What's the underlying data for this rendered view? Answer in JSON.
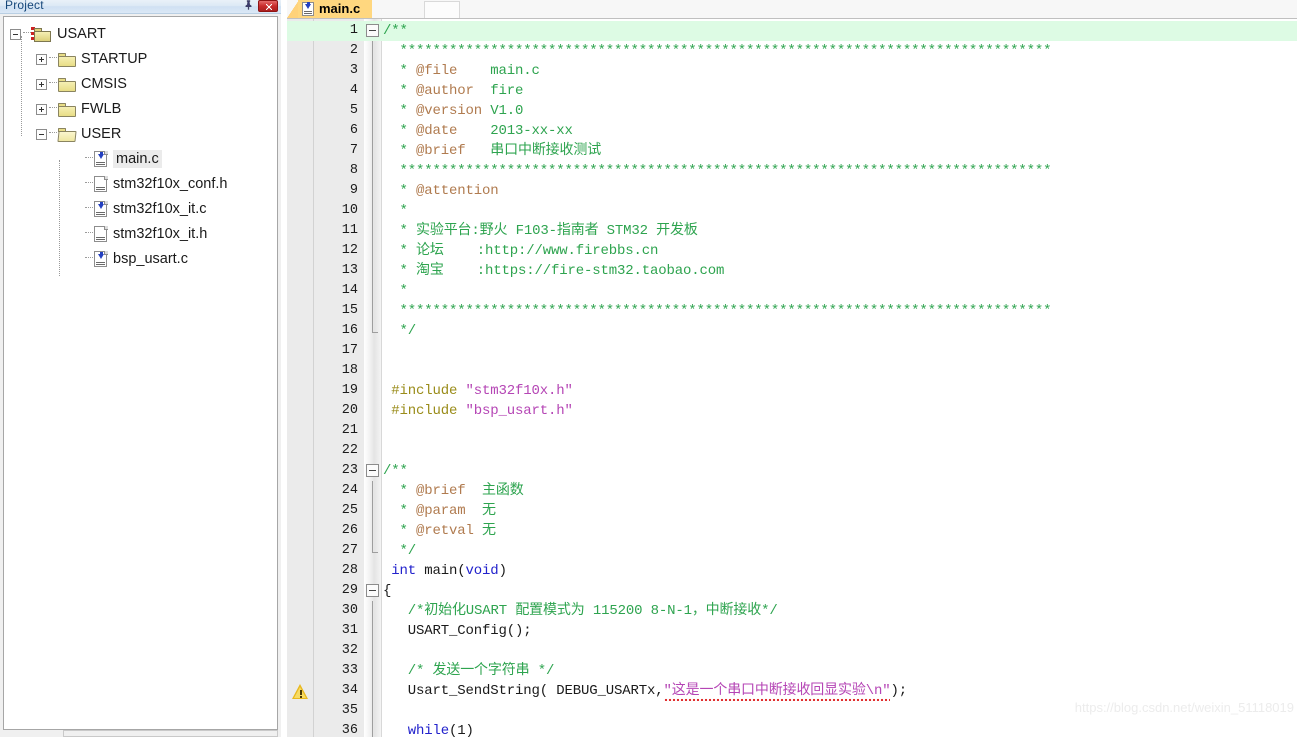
{
  "panel": {
    "title": "Project",
    "pin_icon": "pushpin-icon",
    "close_icon": "close-icon"
  },
  "tree": [
    {
      "label": "USART",
      "depth": 0,
      "icon": "project-folder-icon",
      "expander": "minus",
      "selected": false
    },
    {
      "label": "STARTUP",
      "depth": 1,
      "icon": "folder-icon",
      "expander": "plus",
      "selected": false
    },
    {
      "label": "CMSIS",
      "depth": 1,
      "icon": "folder-icon",
      "expander": "plus",
      "selected": false
    },
    {
      "label": "FWLB",
      "depth": 1,
      "icon": "folder-icon",
      "expander": "plus",
      "selected": false
    },
    {
      "label": "USER",
      "depth": 1,
      "icon": "folder-open-icon",
      "expander": "minus",
      "selected": false
    },
    {
      "label": "main.c",
      "depth": 2,
      "icon": "c-source-file-icon",
      "expander": "none",
      "selected": true
    },
    {
      "label": "stm32f10x_conf.h",
      "depth": 2,
      "icon": "header-file-icon",
      "expander": "none",
      "selected": false
    },
    {
      "label": "stm32f10x_it.c",
      "depth": 2,
      "icon": "c-source-file-icon",
      "expander": "none",
      "selected": false
    },
    {
      "label": "stm32f10x_it.h",
      "depth": 2,
      "icon": "header-file-icon",
      "expander": "none",
      "selected": false
    },
    {
      "label": "bsp_usart.c",
      "depth": 2,
      "icon": "c-source-file-icon",
      "expander": "none",
      "selected": false
    }
  ],
  "editor": {
    "active_tab": "main.c",
    "tab_icon": "c-source-file-icon",
    "lines": [
      {
        "n": 1,
        "fold": "start",
        "warn": false,
        "hl": true,
        "tokens": [
          {
            "t": "/**",
            "c": "cmt"
          }
        ]
      },
      {
        "n": 2,
        "fold": "body",
        "warn": false,
        "hl": false,
        "tokens": [
          {
            "t": "  *******************************************************************************",
            "c": "cmt"
          }
        ]
      },
      {
        "n": 3,
        "fold": "body",
        "warn": false,
        "hl": false,
        "tokens": [
          {
            "t": "  * ",
            "c": "cmt"
          },
          {
            "t": "@file",
            "c": "tag"
          },
          {
            "t": "    main.c",
            "c": "cmt"
          }
        ]
      },
      {
        "n": 4,
        "fold": "body",
        "warn": false,
        "hl": false,
        "tokens": [
          {
            "t": "  * ",
            "c": "cmt"
          },
          {
            "t": "@author",
            "c": "tag"
          },
          {
            "t": "  fire",
            "c": "cmt"
          }
        ]
      },
      {
        "n": 5,
        "fold": "body",
        "warn": false,
        "hl": false,
        "tokens": [
          {
            "t": "  * ",
            "c": "cmt"
          },
          {
            "t": "@version",
            "c": "tag"
          },
          {
            "t": " V1.0",
            "c": "cmt"
          }
        ]
      },
      {
        "n": 6,
        "fold": "body",
        "warn": false,
        "hl": false,
        "tokens": [
          {
            "t": "  * ",
            "c": "cmt"
          },
          {
            "t": "@date",
            "c": "tag"
          },
          {
            "t": "    2013-xx-xx",
            "c": "cmt"
          }
        ]
      },
      {
        "n": 7,
        "fold": "body",
        "warn": false,
        "hl": false,
        "tokens": [
          {
            "t": "  * ",
            "c": "cmt"
          },
          {
            "t": "@brief",
            "c": "tag"
          },
          {
            "t": "   串口中断接收测试",
            "c": "cmt"
          }
        ]
      },
      {
        "n": 8,
        "fold": "body",
        "warn": false,
        "hl": false,
        "tokens": [
          {
            "t": "  *******************************************************************************",
            "c": "cmt"
          }
        ]
      },
      {
        "n": 9,
        "fold": "body",
        "warn": false,
        "hl": false,
        "tokens": [
          {
            "t": "  * ",
            "c": "cmt"
          },
          {
            "t": "@attention",
            "c": "tag"
          }
        ]
      },
      {
        "n": 10,
        "fold": "body",
        "warn": false,
        "hl": false,
        "tokens": [
          {
            "t": "  *",
            "c": "cmt"
          }
        ]
      },
      {
        "n": 11,
        "fold": "body",
        "warn": false,
        "hl": false,
        "tokens": [
          {
            "t": "  * 实验平台:野火 F103-指南者 STM32 开发板",
            "c": "cmt"
          }
        ]
      },
      {
        "n": 12,
        "fold": "body",
        "warn": false,
        "hl": false,
        "tokens": [
          {
            "t": "  * 论坛    :http://www.firebbs.cn",
            "c": "cmt"
          }
        ]
      },
      {
        "n": 13,
        "fold": "body",
        "warn": false,
        "hl": false,
        "tokens": [
          {
            "t": "  * 淘宝    :https://fire-stm32.taobao.com",
            "c": "cmt"
          }
        ]
      },
      {
        "n": 14,
        "fold": "body",
        "warn": false,
        "hl": false,
        "tokens": [
          {
            "t": "  *",
            "c": "cmt"
          }
        ]
      },
      {
        "n": 15,
        "fold": "body",
        "warn": false,
        "hl": false,
        "tokens": [
          {
            "t": "  *******************************************************************************",
            "c": "cmt"
          }
        ]
      },
      {
        "n": 16,
        "fold": "end",
        "warn": false,
        "hl": false,
        "tokens": [
          {
            "t": "  */",
            "c": "cmt"
          }
        ]
      },
      {
        "n": 17,
        "fold": "none",
        "warn": false,
        "hl": false,
        "tokens": []
      },
      {
        "n": 18,
        "fold": "none",
        "warn": false,
        "hl": false,
        "tokens": []
      },
      {
        "n": 19,
        "fold": "none",
        "warn": false,
        "hl": false,
        "tokens": [
          {
            "t": " #include ",
            "c": "pre"
          },
          {
            "t": "\"stm32f10x.h\"",
            "c": "str"
          }
        ]
      },
      {
        "n": 20,
        "fold": "none",
        "warn": false,
        "hl": false,
        "tokens": [
          {
            "t": " #include ",
            "c": "pre"
          },
          {
            "t": "\"bsp_usart.h\"",
            "c": "str"
          }
        ]
      },
      {
        "n": 21,
        "fold": "none",
        "warn": false,
        "hl": false,
        "tokens": []
      },
      {
        "n": 22,
        "fold": "none",
        "warn": false,
        "hl": false,
        "tokens": []
      },
      {
        "n": 23,
        "fold": "start",
        "warn": false,
        "hl": false,
        "tokens": [
          {
            "t": "/**",
            "c": "cmt"
          }
        ]
      },
      {
        "n": 24,
        "fold": "body",
        "warn": false,
        "hl": false,
        "tokens": [
          {
            "t": "  * ",
            "c": "cmt"
          },
          {
            "t": "@brief",
            "c": "tag"
          },
          {
            "t": "  主函数",
            "c": "cmt"
          }
        ]
      },
      {
        "n": 25,
        "fold": "body",
        "warn": false,
        "hl": false,
        "tokens": [
          {
            "t": "  * ",
            "c": "cmt"
          },
          {
            "t": "@param",
            "c": "tag"
          },
          {
            "t": "  无",
            "c": "cmt"
          }
        ]
      },
      {
        "n": 26,
        "fold": "body",
        "warn": false,
        "hl": false,
        "tokens": [
          {
            "t": "  * ",
            "c": "cmt"
          },
          {
            "t": "@retval",
            "c": "tag"
          },
          {
            "t": " 无",
            "c": "cmt"
          }
        ]
      },
      {
        "n": 27,
        "fold": "end",
        "warn": false,
        "hl": false,
        "tokens": [
          {
            "t": "  */",
            "c": "cmt"
          }
        ]
      },
      {
        "n": 28,
        "fold": "none",
        "warn": false,
        "hl": false,
        "tokens": [
          {
            "t": " ",
            "c": "plain"
          },
          {
            "t": "int",
            "c": "kw"
          },
          {
            "t": " main(",
            "c": "plain"
          },
          {
            "t": "void",
            "c": "kw"
          },
          {
            "t": ")",
            "c": "plain"
          }
        ]
      },
      {
        "n": 29,
        "fold": "start",
        "warn": false,
        "hl": false,
        "tokens": [
          {
            "t": "{",
            "c": "plain"
          }
        ]
      },
      {
        "n": 30,
        "fold": "body",
        "warn": false,
        "hl": false,
        "tokens": [
          {
            "t": "   /*初始化USART 配置模式为 115200 8-N-1，中断接收*/",
            "c": "cmt"
          }
        ]
      },
      {
        "n": 31,
        "fold": "body",
        "warn": false,
        "hl": false,
        "tokens": [
          {
            "t": "   USART_Config();",
            "c": "plain"
          }
        ]
      },
      {
        "n": 32,
        "fold": "body",
        "warn": false,
        "hl": false,
        "tokens": []
      },
      {
        "n": 33,
        "fold": "body",
        "warn": false,
        "hl": false,
        "tokens": [
          {
            "t": "   /* 发送一个字符串 */",
            "c": "cmt"
          }
        ]
      },
      {
        "n": 34,
        "fold": "body",
        "warn": true,
        "hl": false,
        "tokens": [
          {
            "t": "   Usart_SendString( DEBUG_USARTx,",
            "c": "plain"
          },
          {
            "t": "\"这是一个串口中断接收回显实验\\n\"",
            "c": "str",
            "squiggle": true
          },
          {
            "t": ");",
            "c": "plain"
          }
        ]
      },
      {
        "n": 35,
        "fold": "body",
        "warn": false,
        "hl": false,
        "tokens": []
      },
      {
        "n": 36,
        "fold": "body",
        "warn": false,
        "hl": false,
        "tokens": [
          {
            "t": "   ",
            "c": "plain"
          },
          {
            "t": "while",
            "c": "kw"
          },
          {
            "t": "(1)",
            "c": "plain"
          }
        ]
      }
    ]
  },
  "watermark": "https://blog.csdn.net/weixin_51118019"
}
